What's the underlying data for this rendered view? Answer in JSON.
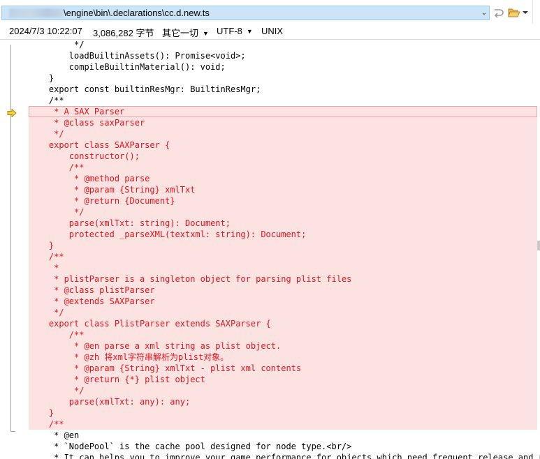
{
  "window": {
    "path_text": "\\engine\\bin\\.declarations\\cc.d.new.ts"
  },
  "infobar": {
    "datetime": "2024/7/3 10:22:07",
    "size": "3,086,282 字节",
    "encoding_group": "其它一切",
    "encoding": "UTF-8",
    "line_ending": "UNIX"
  },
  "colors": {
    "highlight_bg": "#fde2e2",
    "highlight_text": "#e5141b",
    "path_bg": "#cce4f7"
  },
  "icons": {
    "path_dropdown": "chevron-down-icon",
    "go": "reload-arrow-icon",
    "open": "folder-open-icon",
    "current_line": "bookmark-arrow-icon"
  },
  "code_lines": [
    {
      "text": "         */",
      "hl": false
    },
    {
      "text": "        loadBuiltinAssets(): Promise<void>;",
      "hl": false
    },
    {
      "text": "        compileBuiltinMaterial(): void;",
      "hl": false
    },
    {
      "text": "    }",
      "hl": false
    },
    {
      "text": "    export const builtinResMgr: BuiltinResMgr;",
      "hl": false
    },
    {
      "text": "    /**",
      "hl": false
    },
    {
      "text": "     * A SAX Parser",
      "hl": true,
      "current": true
    },
    {
      "text": "     * @class saxParser",
      "hl": true
    },
    {
      "text": "     */",
      "hl": true
    },
    {
      "text": "    export class SAXParser {",
      "hl": true
    },
    {
      "text": "        constructor();",
      "hl": true
    },
    {
      "text": "        /**",
      "hl": true
    },
    {
      "text": "         * @method parse",
      "hl": true
    },
    {
      "text": "         * @param {String} xmlTxt",
      "hl": true
    },
    {
      "text": "         * @return {Document}",
      "hl": true
    },
    {
      "text": "         */",
      "hl": true
    },
    {
      "text": "        parse(xmlTxt: string): Document;",
      "hl": true
    },
    {
      "text": "        protected _parseXML(textxml: string): Document;",
      "hl": true
    },
    {
      "text": "    }",
      "hl": true
    },
    {
      "text": "    /**",
      "hl": true
    },
    {
      "text": "     *",
      "hl": true
    },
    {
      "text": "     * plistParser is a singleton object for parsing plist files",
      "hl": true
    },
    {
      "text": "     * @class plistParser",
      "hl": true
    },
    {
      "text": "     * @extends SAXParser",
      "hl": true
    },
    {
      "text": "     */",
      "hl": true
    },
    {
      "text": "    export class PlistParser extends SAXParser {",
      "hl": true
    },
    {
      "text": "        /**",
      "hl": true
    },
    {
      "text": "         * @en parse a xml string as plist object.",
      "hl": true
    },
    {
      "text": "         * @zh 将xml字符串解析为plist对象。",
      "hl": true
    },
    {
      "text": "         * @param {String} xmlTxt - plist xml contents",
      "hl": true
    },
    {
      "text": "         * @return {*} plist object",
      "hl": true
    },
    {
      "text": "         */",
      "hl": true
    },
    {
      "text": "        parse(xmlTxt: any): any;",
      "hl": true
    },
    {
      "text": "    }",
      "hl": true
    },
    {
      "text": "    /**",
      "hl": true
    },
    {
      "text": "     * @en",
      "hl": false
    },
    {
      "text": "     * `NodePool` is the cache pool designed for node type.<br/>",
      "hl": false
    },
    {
      "text": "     * It can helps you to improve your game performance for objects which need frequent release and re",
      "hl": false
    }
  ]
}
